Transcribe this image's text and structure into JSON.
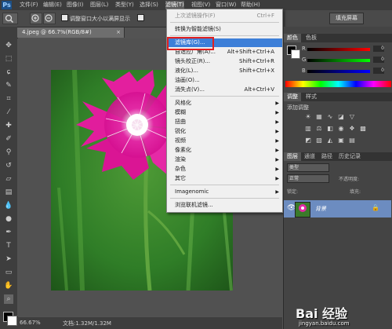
{
  "menubar": {
    "app_logo": "Ps",
    "items": [
      "文件(F)",
      "编辑(E)",
      "图像(I)",
      "图层(L)",
      "类型(Y)",
      "选择(S)",
      "滤镜(T)",
      "视图(V)",
      "窗口(W)",
      "帮助(H)"
    ],
    "active_index": 6
  },
  "options": {
    "resize_windows_label": "调整窗口大小以满屏显示",
    "fill_screen_label": "填充屏幕"
  },
  "document": {
    "tab_title": "4.jpeg @ 66.7%(RGB/8#)",
    "close_glyph": "×"
  },
  "status": {
    "zoom": "66.67%",
    "doc_info": "文档:1.32M/1.32M"
  },
  "filter_menu": {
    "items": [
      {
        "label": "上次滤镜操作(F)",
        "shortcut": "Ctrl+F",
        "disabled": true
      },
      {
        "sep": true
      },
      {
        "label": "转换为智能滤镜(S)"
      },
      {
        "sep": true
      },
      {
        "label": "滤镜库(G)...",
        "highlight": true
      },
      {
        "label": "自适应广角(A)...",
        "shortcut": "Alt+Shift+Ctrl+A"
      },
      {
        "label": "镜头校正(R)...",
        "shortcut": "Shift+Ctrl+R"
      },
      {
        "label": "液化(L)...",
        "shortcut": "Shift+Ctrl+X"
      },
      {
        "label": "油画(O)..."
      },
      {
        "label": "消失点(V)...",
        "shortcut": "Alt+Ctrl+V"
      },
      {
        "sep": true
      },
      {
        "label": "风格化",
        "submenu": true
      },
      {
        "label": "模糊",
        "submenu": true
      },
      {
        "label": "扭曲",
        "submenu": true
      },
      {
        "label": "锐化",
        "submenu": true
      },
      {
        "label": "视频",
        "submenu": true
      },
      {
        "label": "像素化",
        "submenu": true
      },
      {
        "label": "渲染",
        "submenu": true
      },
      {
        "label": "杂色",
        "submenu": true
      },
      {
        "label": "其它",
        "submenu": true
      },
      {
        "sep": true
      },
      {
        "label": "Imagenomic",
        "submenu": true
      },
      {
        "sep": true
      },
      {
        "label": "浏览联机滤镜..."
      }
    ]
  },
  "panels": {
    "color_tabs": [
      "颜色",
      "色板"
    ],
    "sliders": [
      {
        "label": "R",
        "value": "0"
      },
      {
        "label": "G",
        "value": "0"
      },
      {
        "label": "B",
        "value": "0"
      }
    ],
    "adjust_tabs": [
      "调整",
      "样式"
    ],
    "adjust_title": "添加调整",
    "layers_tabs": [
      "图层",
      "通道",
      "路径",
      "历史记录"
    ],
    "kind_label": "类型",
    "blend_mode": "正常",
    "opacity_label": "不透明度:",
    "lock_label": "锁定:",
    "fill_label": "填充:",
    "layer_name": "背景"
  },
  "watermark": {
    "brand": "Bai 经验",
    "url": "jingyan.baidu.com"
  },
  "colors": {
    "menu_highlight": "#3d7fd8",
    "callout_border": "#e02020",
    "layer_selected": "#6c8cc0"
  }
}
